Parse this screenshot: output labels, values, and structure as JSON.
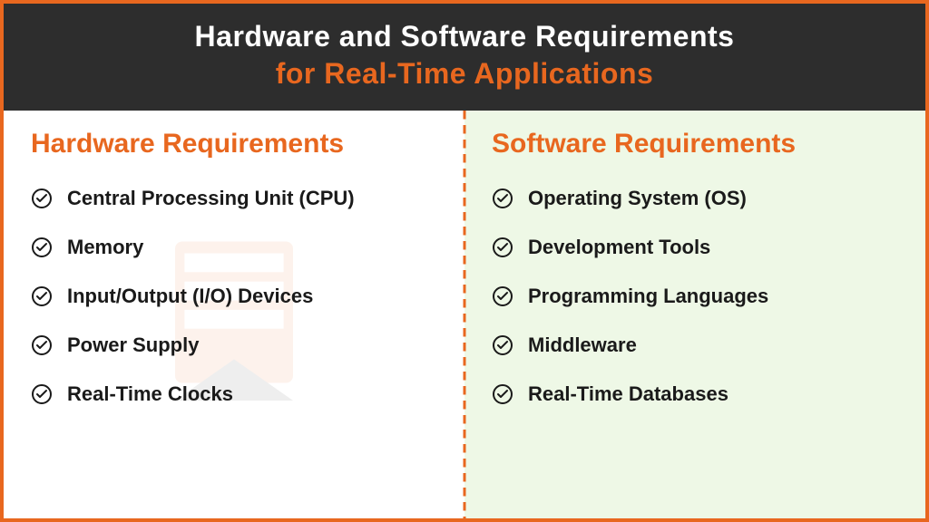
{
  "header": {
    "title_line1": "Hardware and Software Requirements",
    "title_line2": "for Real-Time Applications"
  },
  "columns": {
    "left": {
      "title": "Hardware Requirements",
      "items": [
        "Central Processing Unit (CPU)",
        "Memory",
        "Input/Output (I/O) Devices",
        "Power Supply",
        "Real-Time Clocks"
      ]
    },
    "right": {
      "title": "Software Requirements",
      "items": [
        "Operating System (OS)",
        "Development Tools",
        "Programming Languages",
        "Middleware",
        "Real-Time Databases"
      ]
    }
  }
}
